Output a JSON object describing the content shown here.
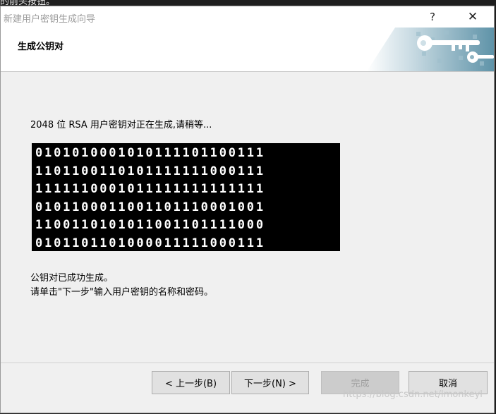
{
  "background": {
    "text": "的前头按钮。"
  },
  "window": {
    "title": "新建用户密钥生成向导",
    "help_glyph": "?",
    "close_glyph": "✕"
  },
  "header": {
    "title": "生成公钥对"
  },
  "main": {
    "status_text": "2048 位 RSA 用户密钥对正在生成,请稍等...",
    "bit_rows": [
      "0101010001010111101100111",
      "1101100110101111111000111",
      "1111110001011111111111111",
      "0101100011001101110001001",
      "1100110101011001101111000",
      "0101101101000011111000111"
    ],
    "success_line1": "公钥对已成功生成。",
    "success_line2": "请单击\"下一步\"输入用户密钥的名称和密码。"
  },
  "buttons": {
    "back": "< 上一步(B)",
    "next": "下一步(N) >",
    "finish": "完成",
    "cancel": "取消"
  },
  "watermark": "https://blog.csdn.net/lmonkeyl"
}
